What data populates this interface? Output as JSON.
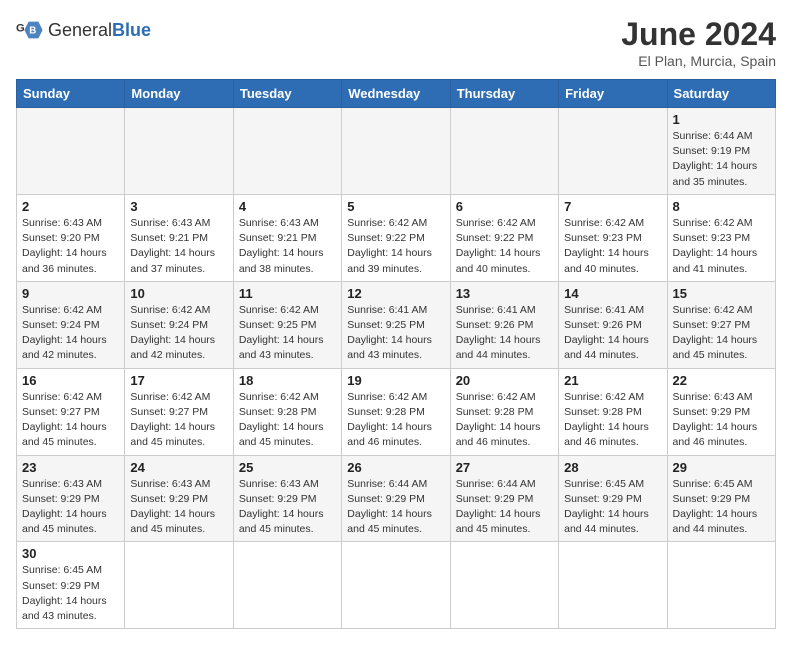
{
  "header": {
    "logo_general": "General",
    "logo_blue": "Blue",
    "title": "June 2024",
    "subtitle": "El Plan, Murcia, Spain"
  },
  "days_of_week": [
    "Sunday",
    "Monday",
    "Tuesday",
    "Wednesday",
    "Thursday",
    "Friday",
    "Saturday"
  ],
  "weeks": [
    [
      {
        "day": "",
        "info": ""
      },
      {
        "day": "",
        "info": ""
      },
      {
        "day": "",
        "info": ""
      },
      {
        "day": "",
        "info": ""
      },
      {
        "day": "",
        "info": ""
      },
      {
        "day": "",
        "info": ""
      },
      {
        "day": "1",
        "info": "Sunrise: 6:44 AM\nSunset: 9:19 PM\nDaylight: 14 hours and 35 minutes."
      }
    ],
    [
      {
        "day": "2",
        "info": "Sunrise: 6:43 AM\nSunset: 9:20 PM\nDaylight: 14 hours and 36 minutes."
      },
      {
        "day": "3",
        "info": "Sunrise: 6:43 AM\nSunset: 9:21 PM\nDaylight: 14 hours and 37 minutes."
      },
      {
        "day": "4",
        "info": "Sunrise: 6:43 AM\nSunset: 9:21 PM\nDaylight: 14 hours and 38 minutes."
      },
      {
        "day": "5",
        "info": "Sunrise: 6:42 AM\nSunset: 9:22 PM\nDaylight: 14 hours and 39 minutes."
      },
      {
        "day": "6",
        "info": "Sunrise: 6:42 AM\nSunset: 9:22 PM\nDaylight: 14 hours and 40 minutes."
      },
      {
        "day": "7",
        "info": "Sunrise: 6:42 AM\nSunset: 9:23 PM\nDaylight: 14 hours and 40 minutes."
      },
      {
        "day": "8",
        "info": "Sunrise: 6:42 AM\nSunset: 9:23 PM\nDaylight: 14 hours and 41 minutes."
      }
    ],
    [
      {
        "day": "9",
        "info": "Sunrise: 6:42 AM\nSunset: 9:24 PM\nDaylight: 14 hours and 42 minutes."
      },
      {
        "day": "10",
        "info": "Sunrise: 6:42 AM\nSunset: 9:24 PM\nDaylight: 14 hours and 42 minutes."
      },
      {
        "day": "11",
        "info": "Sunrise: 6:42 AM\nSunset: 9:25 PM\nDaylight: 14 hours and 43 minutes."
      },
      {
        "day": "12",
        "info": "Sunrise: 6:41 AM\nSunset: 9:25 PM\nDaylight: 14 hours and 43 minutes."
      },
      {
        "day": "13",
        "info": "Sunrise: 6:41 AM\nSunset: 9:26 PM\nDaylight: 14 hours and 44 minutes."
      },
      {
        "day": "14",
        "info": "Sunrise: 6:41 AM\nSunset: 9:26 PM\nDaylight: 14 hours and 44 minutes."
      },
      {
        "day": "15",
        "info": "Sunrise: 6:42 AM\nSunset: 9:27 PM\nDaylight: 14 hours and 45 minutes."
      }
    ],
    [
      {
        "day": "16",
        "info": "Sunrise: 6:42 AM\nSunset: 9:27 PM\nDaylight: 14 hours and 45 minutes."
      },
      {
        "day": "17",
        "info": "Sunrise: 6:42 AM\nSunset: 9:27 PM\nDaylight: 14 hours and 45 minutes."
      },
      {
        "day": "18",
        "info": "Sunrise: 6:42 AM\nSunset: 9:28 PM\nDaylight: 14 hours and 45 minutes."
      },
      {
        "day": "19",
        "info": "Sunrise: 6:42 AM\nSunset: 9:28 PM\nDaylight: 14 hours and 46 minutes."
      },
      {
        "day": "20",
        "info": "Sunrise: 6:42 AM\nSunset: 9:28 PM\nDaylight: 14 hours and 46 minutes."
      },
      {
        "day": "21",
        "info": "Sunrise: 6:42 AM\nSunset: 9:28 PM\nDaylight: 14 hours and 46 minutes."
      },
      {
        "day": "22",
        "info": "Sunrise: 6:43 AM\nSunset: 9:29 PM\nDaylight: 14 hours and 46 minutes."
      }
    ],
    [
      {
        "day": "23",
        "info": "Sunrise: 6:43 AM\nSunset: 9:29 PM\nDaylight: 14 hours and 45 minutes."
      },
      {
        "day": "24",
        "info": "Sunrise: 6:43 AM\nSunset: 9:29 PM\nDaylight: 14 hours and 45 minutes."
      },
      {
        "day": "25",
        "info": "Sunrise: 6:43 AM\nSunset: 9:29 PM\nDaylight: 14 hours and 45 minutes."
      },
      {
        "day": "26",
        "info": "Sunrise: 6:44 AM\nSunset: 9:29 PM\nDaylight: 14 hours and 45 minutes."
      },
      {
        "day": "27",
        "info": "Sunrise: 6:44 AM\nSunset: 9:29 PM\nDaylight: 14 hours and 45 minutes."
      },
      {
        "day": "28",
        "info": "Sunrise: 6:45 AM\nSunset: 9:29 PM\nDaylight: 14 hours and 44 minutes."
      },
      {
        "day": "29",
        "info": "Sunrise: 6:45 AM\nSunset: 9:29 PM\nDaylight: 14 hours and 44 minutes."
      }
    ],
    [
      {
        "day": "30",
        "info": "Sunrise: 6:45 AM\nSunset: 9:29 PM\nDaylight: 14 hours and 43 minutes."
      },
      {
        "day": "",
        "info": ""
      },
      {
        "day": "",
        "info": ""
      },
      {
        "day": "",
        "info": ""
      },
      {
        "day": "",
        "info": ""
      },
      {
        "day": "",
        "info": ""
      },
      {
        "day": "",
        "info": ""
      }
    ]
  ],
  "alt_rows": [
    0,
    2,
    4
  ]
}
